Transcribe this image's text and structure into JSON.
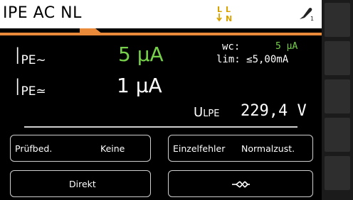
{
  "header": {
    "title": "IPE AC NL",
    "phase_icon": "phase-swap-L-N-icon",
    "probe_icon": "probe-1-icon"
  },
  "measurements": {
    "ipe_ac": {
      "symbol": "I",
      "subscript": "PE~",
      "value": "5 µA"
    },
    "ipe_acdc": {
      "symbol": "I",
      "subscript": "PE≃",
      "value": "1 µA"
    },
    "wc_label": "wc:",
    "wc_value": "5 µA",
    "lim_label": "lim: ≤5,00mA",
    "ulpe_label": "U",
    "ulpe_sub": "LPE",
    "ulpe_value": "229,4 V"
  },
  "buttons": {
    "test_condition": {
      "label": "Prüfbed.",
      "value": "Keine"
    },
    "single_fault": {
      "label": "Einzelfehler",
      "value": "Normalzust."
    },
    "connection": {
      "label": "Direkt"
    },
    "polarity": {
      "icon": "polarity-swap-icon"
    }
  },
  "colors": {
    "accent_orange": "#e98a3a",
    "value_green": "#76d04a",
    "background": "#000000"
  }
}
